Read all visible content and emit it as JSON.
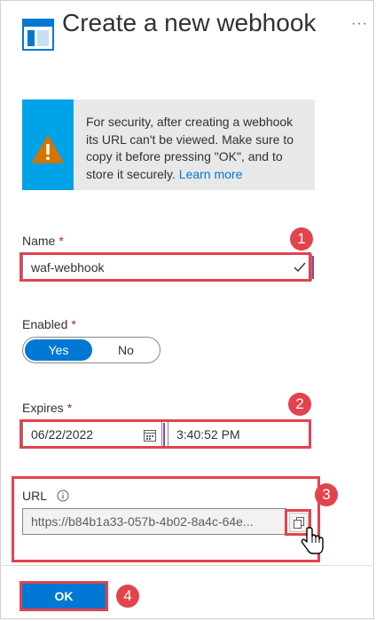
{
  "header": {
    "title": "Create a new webhook",
    "more_label": "···",
    "icon": "webhook-blade-icon"
  },
  "warning": {
    "icon": "warning-icon",
    "message": "For security, after creating a webhook its URL can't be viewed. Make sure to copy it before pressing \"OK\", and to store it securely.",
    "link_label": "Learn more"
  },
  "form": {
    "name": {
      "label": "Name",
      "required_mark": "*",
      "value": "waf-webhook"
    },
    "enabled": {
      "label": "Enabled",
      "required_mark": "*",
      "options": [
        "Yes",
        "No"
      ],
      "selected": "Yes"
    },
    "expires": {
      "label": "Expires",
      "required_mark": "*",
      "date": "06/22/2022",
      "time": "3:40:52 PM"
    },
    "url": {
      "label": "URL",
      "info_icon": "info-icon",
      "value": "https://b84b1a33-057b-4b02-8a4c-64e..."
    }
  },
  "annotations": {
    "step1": "1",
    "step2": "2",
    "step3": "3",
    "step4": "4"
  },
  "footer": {
    "ok_label": "OK"
  },
  "colors": {
    "accent": "#0078d4",
    "warning_strip": "#00a2e8",
    "warning_triangle": "#d47500",
    "annotation_red": "#e2434d"
  }
}
